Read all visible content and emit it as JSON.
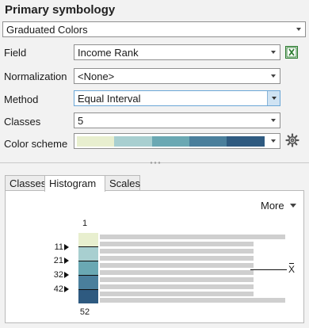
{
  "title": "Primary symbology",
  "renderer": {
    "value": "Graduated Colors"
  },
  "fields": {
    "field": {
      "label": "Field",
      "value": "Income Rank"
    },
    "normalization": {
      "label": "Normalization",
      "value": "<None>"
    },
    "method": {
      "label": "Method",
      "value": "Equal Interval"
    },
    "classes": {
      "label": "Classes",
      "value": "5"
    },
    "color_scheme": {
      "label": "Color scheme",
      "colors": [
        "#e8efcf",
        "#a8cfd0",
        "#6aa8b3",
        "#4a7f9c",
        "#2e5a80"
      ]
    }
  },
  "icons": {
    "excel": "excel-table-icon",
    "gear": "gear-icon"
  },
  "tabs": [
    {
      "label": "Classes",
      "active": false
    },
    {
      "label": "Histogram",
      "active": true
    },
    {
      "label": "Scales",
      "active": false
    }
  ],
  "histogram": {
    "more_label": "More",
    "min_label": "1",
    "max_label": "52",
    "breaks": [
      "11",
      "21",
      "32",
      "42"
    ],
    "mean_symbol": "X"
  }
}
